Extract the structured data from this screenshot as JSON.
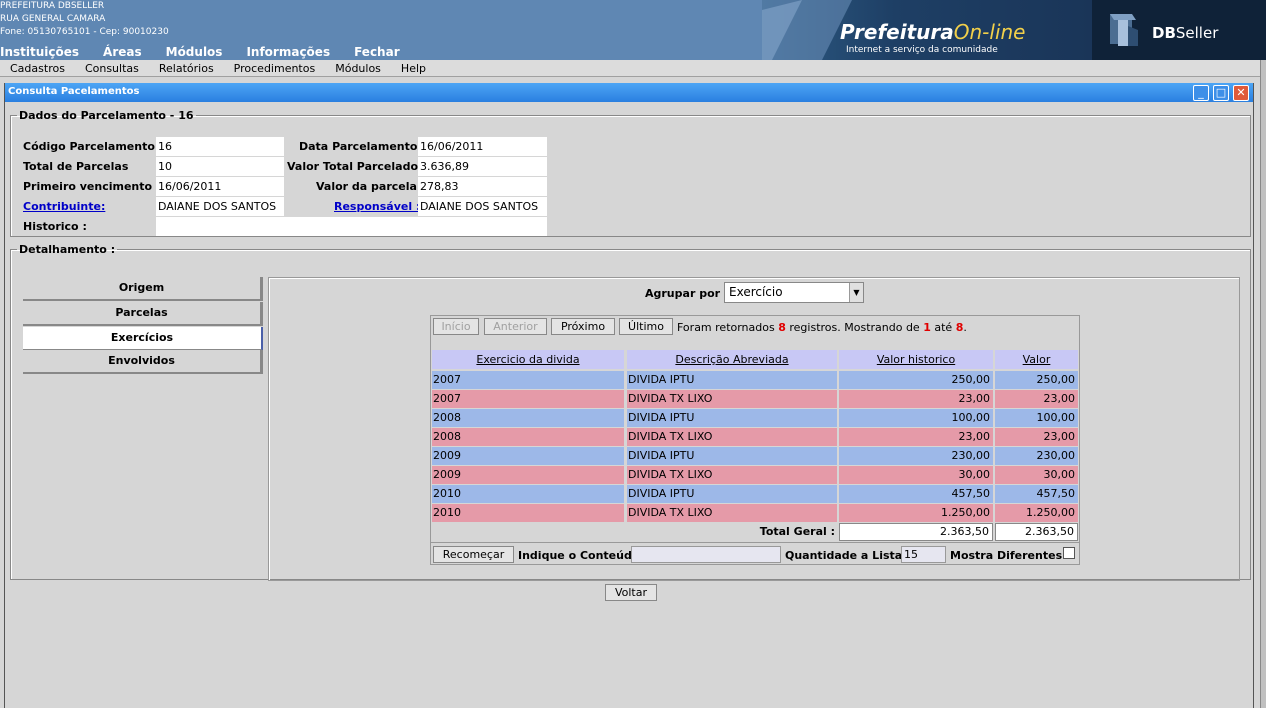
{
  "header": {
    "org_name": "PREFEITURA DBSELLER",
    "address": "RUA GENERAL CAMARA",
    "contact": "Fone: 05130765101  -  Cep: 90010230",
    "nav": [
      "Instituições",
      "Áreas",
      "Módulos",
      "Informações",
      "Fechar"
    ],
    "logo_main": "Prefeitura",
    "logo_online": "On-line",
    "logo_sub": "Internet a serviço da comunidade",
    "db_logo_bold": "DB",
    "db_logo_rest": "Seller"
  },
  "menubar": [
    "Cadastros",
    "Consultas",
    "Relatórios",
    "Procedimentos",
    "Módulos",
    "Help"
  ],
  "window": {
    "title": "Consulta Pacelamentos",
    "minimize": "_",
    "maximize": "□",
    "close": "✕"
  },
  "dados": {
    "legend": "Dados do Parcelamento - 16",
    "codigo_label": "Código Parcelamento :",
    "codigo_value": "16",
    "data_label": "Data Parcelamento :",
    "data_value": "16/06/2011",
    "total_parcelas_label": "Total de Parcelas",
    "total_parcelas_value": "10",
    "valor_total_label": "Valor Total Parcelado :",
    "valor_total_value": "3.636,89",
    "primeiro_venc_label": "Primeiro vencimento :",
    "primeiro_venc_value": "16/06/2011",
    "valor_parcela_label": "Valor da parcela :",
    "valor_parcela_value": "278,83",
    "contribuinte_label": "Contribuinte:",
    "contribuinte_value": "DAIANE DOS SANTOS",
    "responsavel_label": "Responsável :",
    "responsavel_value": "DAIANE DOS SANTOS",
    "historico_label": "Historico :",
    "historico_value": ""
  },
  "detalhamento": {
    "legend": "Detalhamento :",
    "tabs": [
      "Origem",
      "Parcelas",
      "Exercícios",
      "Envolvidos"
    ],
    "active_tab": "Exercícios",
    "agrupar_label": "Agrupar por :",
    "agrupar_value": "Exercício"
  },
  "grid": {
    "nav": {
      "inicio": "Início",
      "anterior": "Anterior",
      "proximo": "Próximo",
      "ultimo": "Último"
    },
    "reg_text_1": "Foram retornados ",
    "reg_total": "8",
    "reg_text_2": " registros. Mostrando de ",
    "reg_from": "1",
    "reg_text_3": " até ",
    "reg_to": "8",
    "reg_text_4": ".",
    "columns": [
      "Exercicio da divida",
      "Descrição Abreviada",
      "Valor historico",
      "Valor"
    ],
    "rows": [
      {
        "ano": "2007",
        "descricao": "DIVIDA IPTU",
        "historico": "250,00",
        "valor": "250,00",
        "color": "blue"
      },
      {
        "ano": "2007",
        "descricao": "DIVIDA TX LIXO",
        "historico": "23,00",
        "valor": "23,00",
        "color": "pink"
      },
      {
        "ano": "2008",
        "descricao": "DIVIDA IPTU",
        "historico": "100,00",
        "valor": "100,00",
        "color": "blue"
      },
      {
        "ano": "2008",
        "descricao": "DIVIDA TX LIXO",
        "historico": "23,00",
        "valor": "23,00",
        "color": "pink"
      },
      {
        "ano": "2009",
        "descricao": "DIVIDA IPTU",
        "historico": "230,00",
        "valor": "230,00",
        "color": "blue"
      },
      {
        "ano": "2009",
        "descricao": "DIVIDA TX LIXO",
        "historico": "30,00",
        "valor": "30,00",
        "color": "pink"
      },
      {
        "ano": "2010",
        "descricao": "DIVIDA IPTU",
        "historico": "457,50",
        "valor": "457,50",
        "color": "blue"
      },
      {
        "ano": "2010",
        "descricao": "DIVIDA TX LIXO",
        "historico": "1.250,00",
        "valor": "1.250,00",
        "color": "pink"
      }
    ],
    "total_label": "Total Geral :",
    "total_historico": "2.363,50",
    "total_valor": "2.363,50",
    "recomecar": "Recomeçar",
    "conteudo_label": "Indique o Conteúdo:",
    "conteudo_value": "",
    "qtd_label": "Quantidade a Listar:",
    "qtd_value": "15",
    "mostra_label": "Mostra Diferentes:"
  },
  "voltar": "Voltar",
  "colors": {
    "header_bg": "#5f87b3",
    "titlebar": "#2a7fe0",
    "row_blue": "#9db8e8",
    "row_pink": "#e59aa8",
    "column_header": "#c8c8f5",
    "link": "#0000c8",
    "highlight_red": "#e00000"
  }
}
